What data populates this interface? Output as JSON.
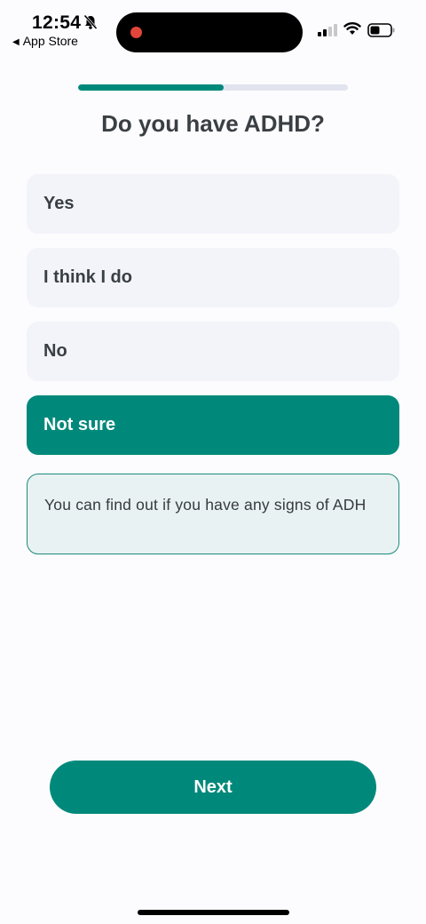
{
  "status_bar": {
    "time": "12:54",
    "back_app": "App Store",
    "icons": [
      "bell-slash-icon",
      "cellular-signal-icon",
      "wifi-icon",
      "battery-icon"
    ],
    "recording_color": "#e2453a"
  },
  "progress": {
    "fraction": 0.54,
    "fill_color": "#00897b",
    "track_color": "#e1e4ef"
  },
  "question": {
    "title": "Do you have ADHD?"
  },
  "options": [
    {
      "label": "Yes",
      "selected": false
    },
    {
      "label": "I think I do",
      "selected": false
    },
    {
      "label": "No",
      "selected": false
    },
    {
      "label": "Not sure",
      "selected": true
    }
  ],
  "hint": {
    "text": "You can find out if you have any signs of ADH"
  },
  "next_button": {
    "label": "Next"
  },
  "colors": {
    "accent": "#00897b",
    "option_bg": "#f2f4fa",
    "hint_bg": "#e9f2f2"
  }
}
